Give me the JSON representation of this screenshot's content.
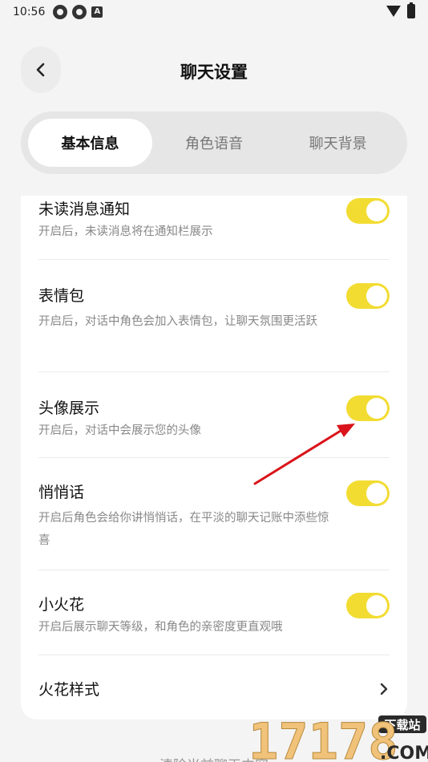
{
  "status_bar": {
    "time": "10:56",
    "icons": [
      "app-notification-icon",
      "app-notification-icon",
      "a-icon",
      "wifi-icon",
      "battery-icon"
    ]
  },
  "header": {
    "title": "聊天设置",
    "back_icon": "chevron-left-icon"
  },
  "tabs": [
    {
      "label": "基本信息",
      "active": true
    },
    {
      "label": "角色语音",
      "active": false
    },
    {
      "label": "聊天背景",
      "active": false
    }
  ],
  "settings": [
    {
      "title": "未读消息通知",
      "desc": "开启后，未读消息将在通知栏展示",
      "enabled": true
    },
    {
      "title": "表情包",
      "desc": "开启后，对话中角色会加入表情包，让聊天氛围更活跃",
      "enabled": true
    },
    {
      "title": "头像展示",
      "desc": "开启后，对话中会展示您的头像",
      "enabled": true
    },
    {
      "title": "悄悄话",
      "desc": "开启后角色会给你讲悄悄话，在平淡的聊天记账中添些惊喜",
      "enabled": true
    },
    {
      "title": "小火花",
      "desc": "开启后展示聊天等级，和角色的亲密度更直观哦",
      "enabled": true
    }
  ],
  "spark_style": {
    "title": "火花样式",
    "icon": "chevron-right-icon"
  },
  "bottom": {
    "text": "清除当前聊天内容"
  },
  "watermark": {
    "number": "17178",
    "domain": ".COM",
    "badge": "下载站"
  },
  "colors": {
    "toggle_on": "#f2dc32",
    "annotation_arrow": "#d9141a"
  }
}
